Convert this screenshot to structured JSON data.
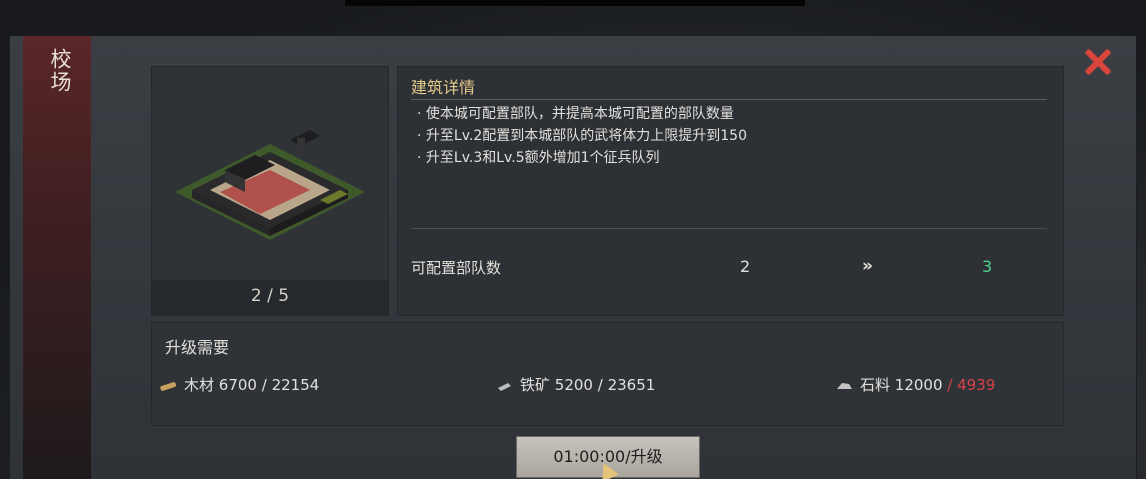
{
  "side_title": "校场",
  "building": {
    "level_text": "2 / 5",
    "image_icon": "city-training-ground"
  },
  "detail": {
    "title": "建筑详情",
    "lines": [
      "· 使本城可配置部队，并提高本城可配置的部队数量",
      "· 升至Lv.2配置到本城部队的武将体力上限提升到150",
      "· 升至Lv.3和Lv.5额外增加1个征兵队列"
    ],
    "stat": {
      "label": "可配置部队数",
      "current": "2",
      "arrow": "»",
      "next": "3"
    }
  },
  "requirements": {
    "title": "升级需要",
    "items": [
      {
        "icon": "wood-icon",
        "name": "木材",
        "have": "6700",
        "sep": " / ",
        "need": "22154"
      },
      {
        "icon": "iron-icon",
        "name": "铁矿",
        "have": "5200",
        "sep": " / ",
        "need": "23651"
      },
      {
        "icon": "stone-icon",
        "name": "石料",
        "have": "12000",
        "sep": " / ",
        "need": "4939"
      }
    ]
  },
  "upgrade_button": "01:00:00/升级",
  "colors": {
    "accent_gold": "#e5c98a",
    "next_green": "#4fd28a",
    "insufficient_red": "#d8424a",
    "close_red": "#d9453b",
    "side_tab": "#5a2628"
  }
}
